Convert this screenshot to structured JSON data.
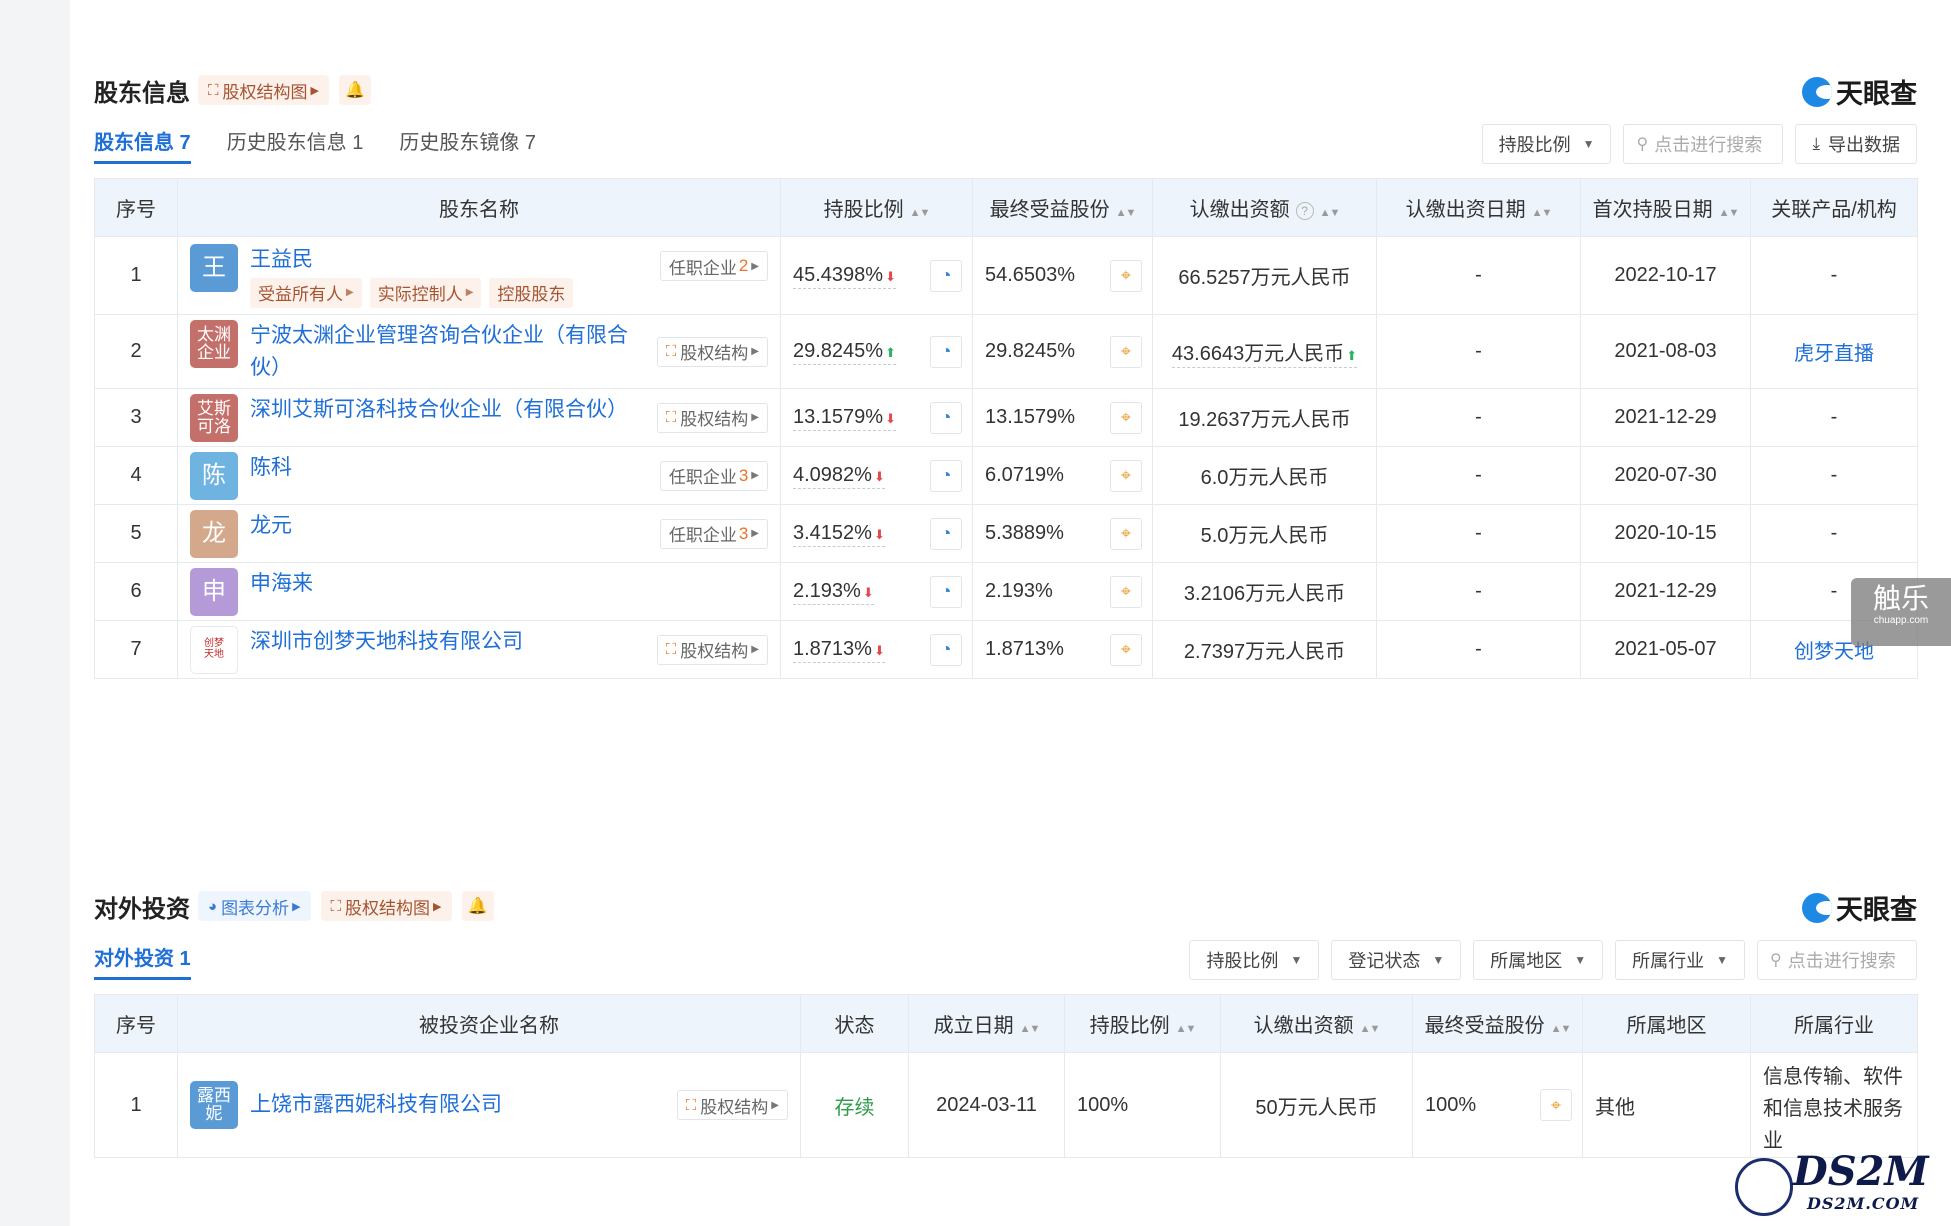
{
  "shareholders": {
    "title": "股东信息",
    "equity_chart_btn": "股权结构图",
    "logo_text": "天眼查",
    "tabs": [
      "股东信息 7",
      "历史股东信息 1",
      "历史股东镜像 7"
    ],
    "toolbar": {
      "filter_ratio": "持股比例",
      "search_placeholder": "点击进行搜索",
      "export": "导出数据"
    },
    "headers": [
      "序号",
      "股东名称",
      "持股比例",
      "最终受益股份",
      "认缴出资额",
      "认缴出资日期",
      "首次持股日期",
      "关联产品/机构"
    ],
    "rows": [
      {
        "no": "1",
        "avatar": "王",
        "avatar_color": "#5b9bd5",
        "name": "王益民",
        "badges": [
          "受益所有人",
          "实际控制人",
          "控股股东"
        ],
        "right_label": "任职企业",
        "right_count": "2",
        "ratio": "45.4398%",
        "trend": "down",
        "final": "54.6503%",
        "capital": "66.5257万元人民币",
        "capital_trend": "",
        "sub_date": "-",
        "first_date": "2022-10-17",
        "related": "-"
      },
      {
        "no": "2",
        "avatar": "太渊企业",
        "avatar_color": "#c4706a",
        "name": "宁波太渊企业管理咨询合伙企业（有限合伙）",
        "badges": [],
        "right_label": "股权结构",
        "right_count": "",
        "ratio": "29.8245%",
        "trend": "up",
        "final": "29.8245%",
        "capital": "43.6643万元人民币",
        "capital_trend": "up",
        "sub_date": "-",
        "first_date": "2021-08-03",
        "related": "虎牙直播"
      },
      {
        "no": "3",
        "avatar": "艾斯可洛",
        "avatar_color": "#c4706a",
        "name": "深圳艾斯可洛科技合伙企业（有限合伙）",
        "badges": [],
        "right_label": "股权结构",
        "right_count": "",
        "ratio": "13.1579%",
        "trend": "down",
        "final": "13.1579%",
        "capital": "19.2637万元人民币",
        "capital_trend": "",
        "sub_date": "-",
        "first_date": "2021-12-29",
        "related": "-"
      },
      {
        "no": "4",
        "avatar": "陈",
        "avatar_color": "#6fb3e0",
        "name": "陈科",
        "badges": [],
        "right_label": "任职企业",
        "right_count": "3",
        "ratio": "4.0982%",
        "trend": "down",
        "final": "6.0719%",
        "capital": "6.0万元人民币",
        "capital_trend": "",
        "sub_date": "-",
        "first_date": "2020-07-30",
        "related": "-"
      },
      {
        "no": "5",
        "avatar": "龙",
        "avatar_color": "#d4a88a",
        "name": "龙元",
        "badges": [],
        "right_label": "任职企业",
        "right_count": "3",
        "ratio": "3.4152%",
        "trend": "down",
        "final": "5.3889%",
        "capital": "5.0万元人民币",
        "capital_trend": "",
        "sub_date": "-",
        "first_date": "2020-10-15",
        "related": "-"
      },
      {
        "no": "6",
        "avatar": "申",
        "avatar_color": "#b59ad8",
        "name": "申海来",
        "badges": [],
        "right_label": "",
        "right_count": "",
        "ratio": "2.193%",
        "trend": "down",
        "final": "2.193%",
        "capital": "3.2106万元人民币",
        "capital_trend": "",
        "sub_date": "-",
        "first_date": "2021-12-29",
        "related": "-"
      },
      {
        "no": "7",
        "avatar": "创梦天地",
        "avatar_color": "logo",
        "name": "深圳市创梦天地科技有限公司",
        "badges": [],
        "right_label": "股权结构",
        "right_count": "",
        "ratio": "1.8713%",
        "trend": "down",
        "final": "1.8713%",
        "capital": "2.7397万元人民币",
        "capital_trend": "",
        "sub_date": "-",
        "first_date": "2021-05-07",
        "related": "创梦天地"
      }
    ]
  },
  "investments": {
    "title": "对外投资",
    "chart_btn": "图表分析",
    "equity_chart_btn": "股权结构图",
    "logo_text": "天眼查",
    "tab": "对外投资 1",
    "filters": [
      "持股比例",
      "登记状态",
      "所属地区",
      "所属行业"
    ],
    "search_placeholder": "点击进行搜索",
    "headers": [
      "序号",
      "被投资企业名称",
      "状态",
      "成立日期",
      "持股比例",
      "认缴出资额",
      "最终受益股份",
      "所属地区",
      "所属行业"
    ],
    "rows": [
      {
        "no": "1",
        "avatar": "露西妮",
        "avatar_color": "#5b9bd5",
        "name": "上饶市露西妮科技有限公司",
        "right_label": "股权结构",
        "status": "存续",
        "date": "2024-03-11",
        "ratio": "100%",
        "capital": "50万元人民币",
        "final": "100%",
        "region": "其他",
        "industry": "信息传输、软件和信息技术服务业"
      }
    ]
  },
  "watermarks": {
    "chule": "触乐",
    "chule_url": "chuapp.com",
    "ds2m": "DS2M",
    "ds2m_url": "DS2M.COM"
  }
}
